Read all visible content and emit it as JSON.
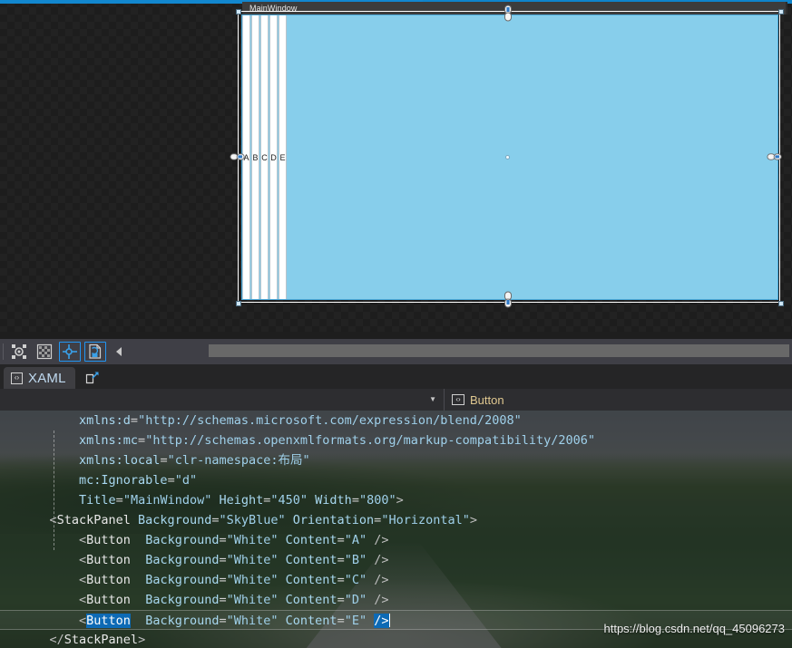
{
  "designer": {
    "window_title": "MainWindow",
    "stackpanel_background": "#87CEEB",
    "buttons": [
      {
        "label": "A"
      },
      {
        "label": "B"
      },
      {
        "label": "C"
      },
      {
        "label": "D"
      },
      {
        "label": "E"
      }
    ],
    "adorners": {
      "top": "chain-link-icon",
      "bottom": "chain-link-icon",
      "left": "chain-link-icon",
      "right": "chain-link-icon",
      "center": "center-dot"
    }
  },
  "toolbar": {
    "buttons": [
      {
        "name": "zoom-fit-icon",
        "active": false
      },
      {
        "name": "snap-grid-icon",
        "active": false
      },
      {
        "name": "artboard-icon",
        "active": false
      },
      {
        "name": "layout-adorner-icon",
        "active": true
      },
      {
        "name": "effects-icon",
        "active": true
      }
    ],
    "collapse_arrow": "◀"
  },
  "tabs": {
    "xaml": {
      "label": "XAML",
      "icon": "‹›"
    },
    "split_view_icon": "split-view-icon"
  },
  "navbar": {
    "dropdown_caret": "▼",
    "element_icon": "‹›",
    "element_label": "Button"
  },
  "editor": {
    "lines": [
      {
        "highlight": false,
        "tokens": [
          {
            "t": "attr",
            "v": "        xmlns:d"
          },
          {
            "t": "eq",
            "v": "="
          },
          {
            "t": "val",
            "v": "\"http://schemas.microsoft.com/expression/blend/2008\""
          }
        ]
      },
      {
        "highlight": false,
        "tokens": [
          {
            "t": "attr",
            "v": "        xmlns:mc"
          },
          {
            "t": "eq",
            "v": "="
          },
          {
            "t": "val",
            "v": "\"http://schemas.openxmlformats.org/markup-compatibility/2006\""
          }
        ]
      },
      {
        "highlight": false,
        "tokens": [
          {
            "t": "attr",
            "v": "        xmlns:local"
          },
          {
            "t": "eq",
            "v": "="
          },
          {
            "t": "val",
            "v": "\"clr-namespace:布局\""
          }
        ]
      },
      {
        "highlight": false,
        "tokens": [
          {
            "t": "attr",
            "v": "        mc:Ignorable"
          },
          {
            "t": "eq",
            "v": "="
          },
          {
            "t": "val",
            "v": "\"d\""
          }
        ]
      },
      {
        "highlight": false,
        "tokens": [
          {
            "t": "attr",
            "v": "        Title"
          },
          {
            "t": "eq",
            "v": "="
          },
          {
            "t": "val",
            "v": "\"MainWindow\""
          },
          {
            "t": "attr",
            "v": " Height"
          },
          {
            "t": "eq",
            "v": "="
          },
          {
            "t": "val",
            "v": "\"450\""
          },
          {
            "t": "attr",
            "v": " Width"
          },
          {
            "t": "eq",
            "v": "="
          },
          {
            "t": "val",
            "v": "\"800\""
          },
          {
            "t": "punc",
            "v": ">"
          }
        ]
      },
      {
        "highlight": false,
        "tokens": [
          {
            "t": "punc",
            "v": "    <"
          },
          {
            "t": "tag",
            "v": "StackPanel"
          },
          {
            "t": "attr",
            "v": " Background"
          },
          {
            "t": "eq",
            "v": "="
          },
          {
            "t": "val",
            "v": "\"SkyBlue\""
          },
          {
            "t": "attr",
            "v": " Orientation"
          },
          {
            "t": "eq",
            "v": "="
          },
          {
            "t": "val",
            "v": "\"Horizontal\""
          },
          {
            "t": "punc",
            "v": ">"
          }
        ]
      },
      {
        "highlight": false,
        "tokens": [
          {
            "t": "punc",
            "v": "        <"
          },
          {
            "t": "tag",
            "v": "Button"
          },
          {
            "t": "attr",
            "v": "  Background"
          },
          {
            "t": "eq",
            "v": "="
          },
          {
            "t": "val",
            "v": "\"White\""
          },
          {
            "t": "attr",
            "v": " Content"
          },
          {
            "t": "eq",
            "v": "="
          },
          {
            "t": "val",
            "v": "\"A\""
          },
          {
            "t": "punc",
            "v": " />"
          }
        ]
      },
      {
        "highlight": false,
        "tokens": [
          {
            "t": "punc",
            "v": "        <"
          },
          {
            "t": "tag",
            "v": "Button"
          },
          {
            "t": "attr",
            "v": "  Background"
          },
          {
            "t": "eq",
            "v": "="
          },
          {
            "t": "val",
            "v": "\"White\""
          },
          {
            "t": "attr",
            "v": " Content"
          },
          {
            "t": "eq",
            "v": "="
          },
          {
            "t": "val",
            "v": "\"B\""
          },
          {
            "t": "punc",
            "v": " />"
          }
        ]
      },
      {
        "highlight": false,
        "tokens": [
          {
            "t": "punc",
            "v": "        <"
          },
          {
            "t": "tag",
            "v": "Button"
          },
          {
            "t": "attr",
            "v": "  Background"
          },
          {
            "t": "eq",
            "v": "="
          },
          {
            "t": "val",
            "v": "\"White\""
          },
          {
            "t": "attr",
            "v": " Content"
          },
          {
            "t": "eq",
            "v": "="
          },
          {
            "t": "val",
            "v": "\"C\""
          },
          {
            "t": "punc",
            "v": " />"
          }
        ]
      },
      {
        "highlight": false,
        "tokens": [
          {
            "t": "punc",
            "v": "        <"
          },
          {
            "t": "tag",
            "v": "Button"
          },
          {
            "t": "attr",
            "v": "  Background"
          },
          {
            "t": "eq",
            "v": "="
          },
          {
            "t": "val",
            "v": "\"White\""
          },
          {
            "t": "attr",
            "v": " Content"
          },
          {
            "t": "eq",
            "v": "="
          },
          {
            "t": "val",
            "v": "\"D\""
          },
          {
            "t": "punc",
            "v": " />"
          }
        ]
      },
      {
        "highlight": true,
        "tokens": [
          {
            "t": "punc",
            "v": "        <"
          },
          {
            "t": "selbg",
            "v": "Button"
          },
          {
            "t": "attr",
            "v": "  Background"
          },
          {
            "t": "eq",
            "v": "="
          },
          {
            "t": "val",
            "v": "\"White\""
          },
          {
            "t": "attr",
            "v": " Content"
          },
          {
            "t": "eq",
            "v": "="
          },
          {
            "t": "val",
            "v": "\"E\""
          },
          {
            "t": "punc",
            "v": " "
          },
          {
            "t": "selbg",
            "v": "/>"
          },
          {
            "t": "caret",
            "v": ""
          }
        ]
      },
      {
        "highlight": false,
        "tokens": [
          {
            "t": "punc",
            "v": "    </"
          },
          {
            "t": "tag",
            "v": "StackPanel"
          },
          {
            "t": "punc",
            "v": ">"
          }
        ]
      }
    ]
  },
  "watermark": {
    "text": "https://blog.csdn.net/qq_45096273"
  }
}
